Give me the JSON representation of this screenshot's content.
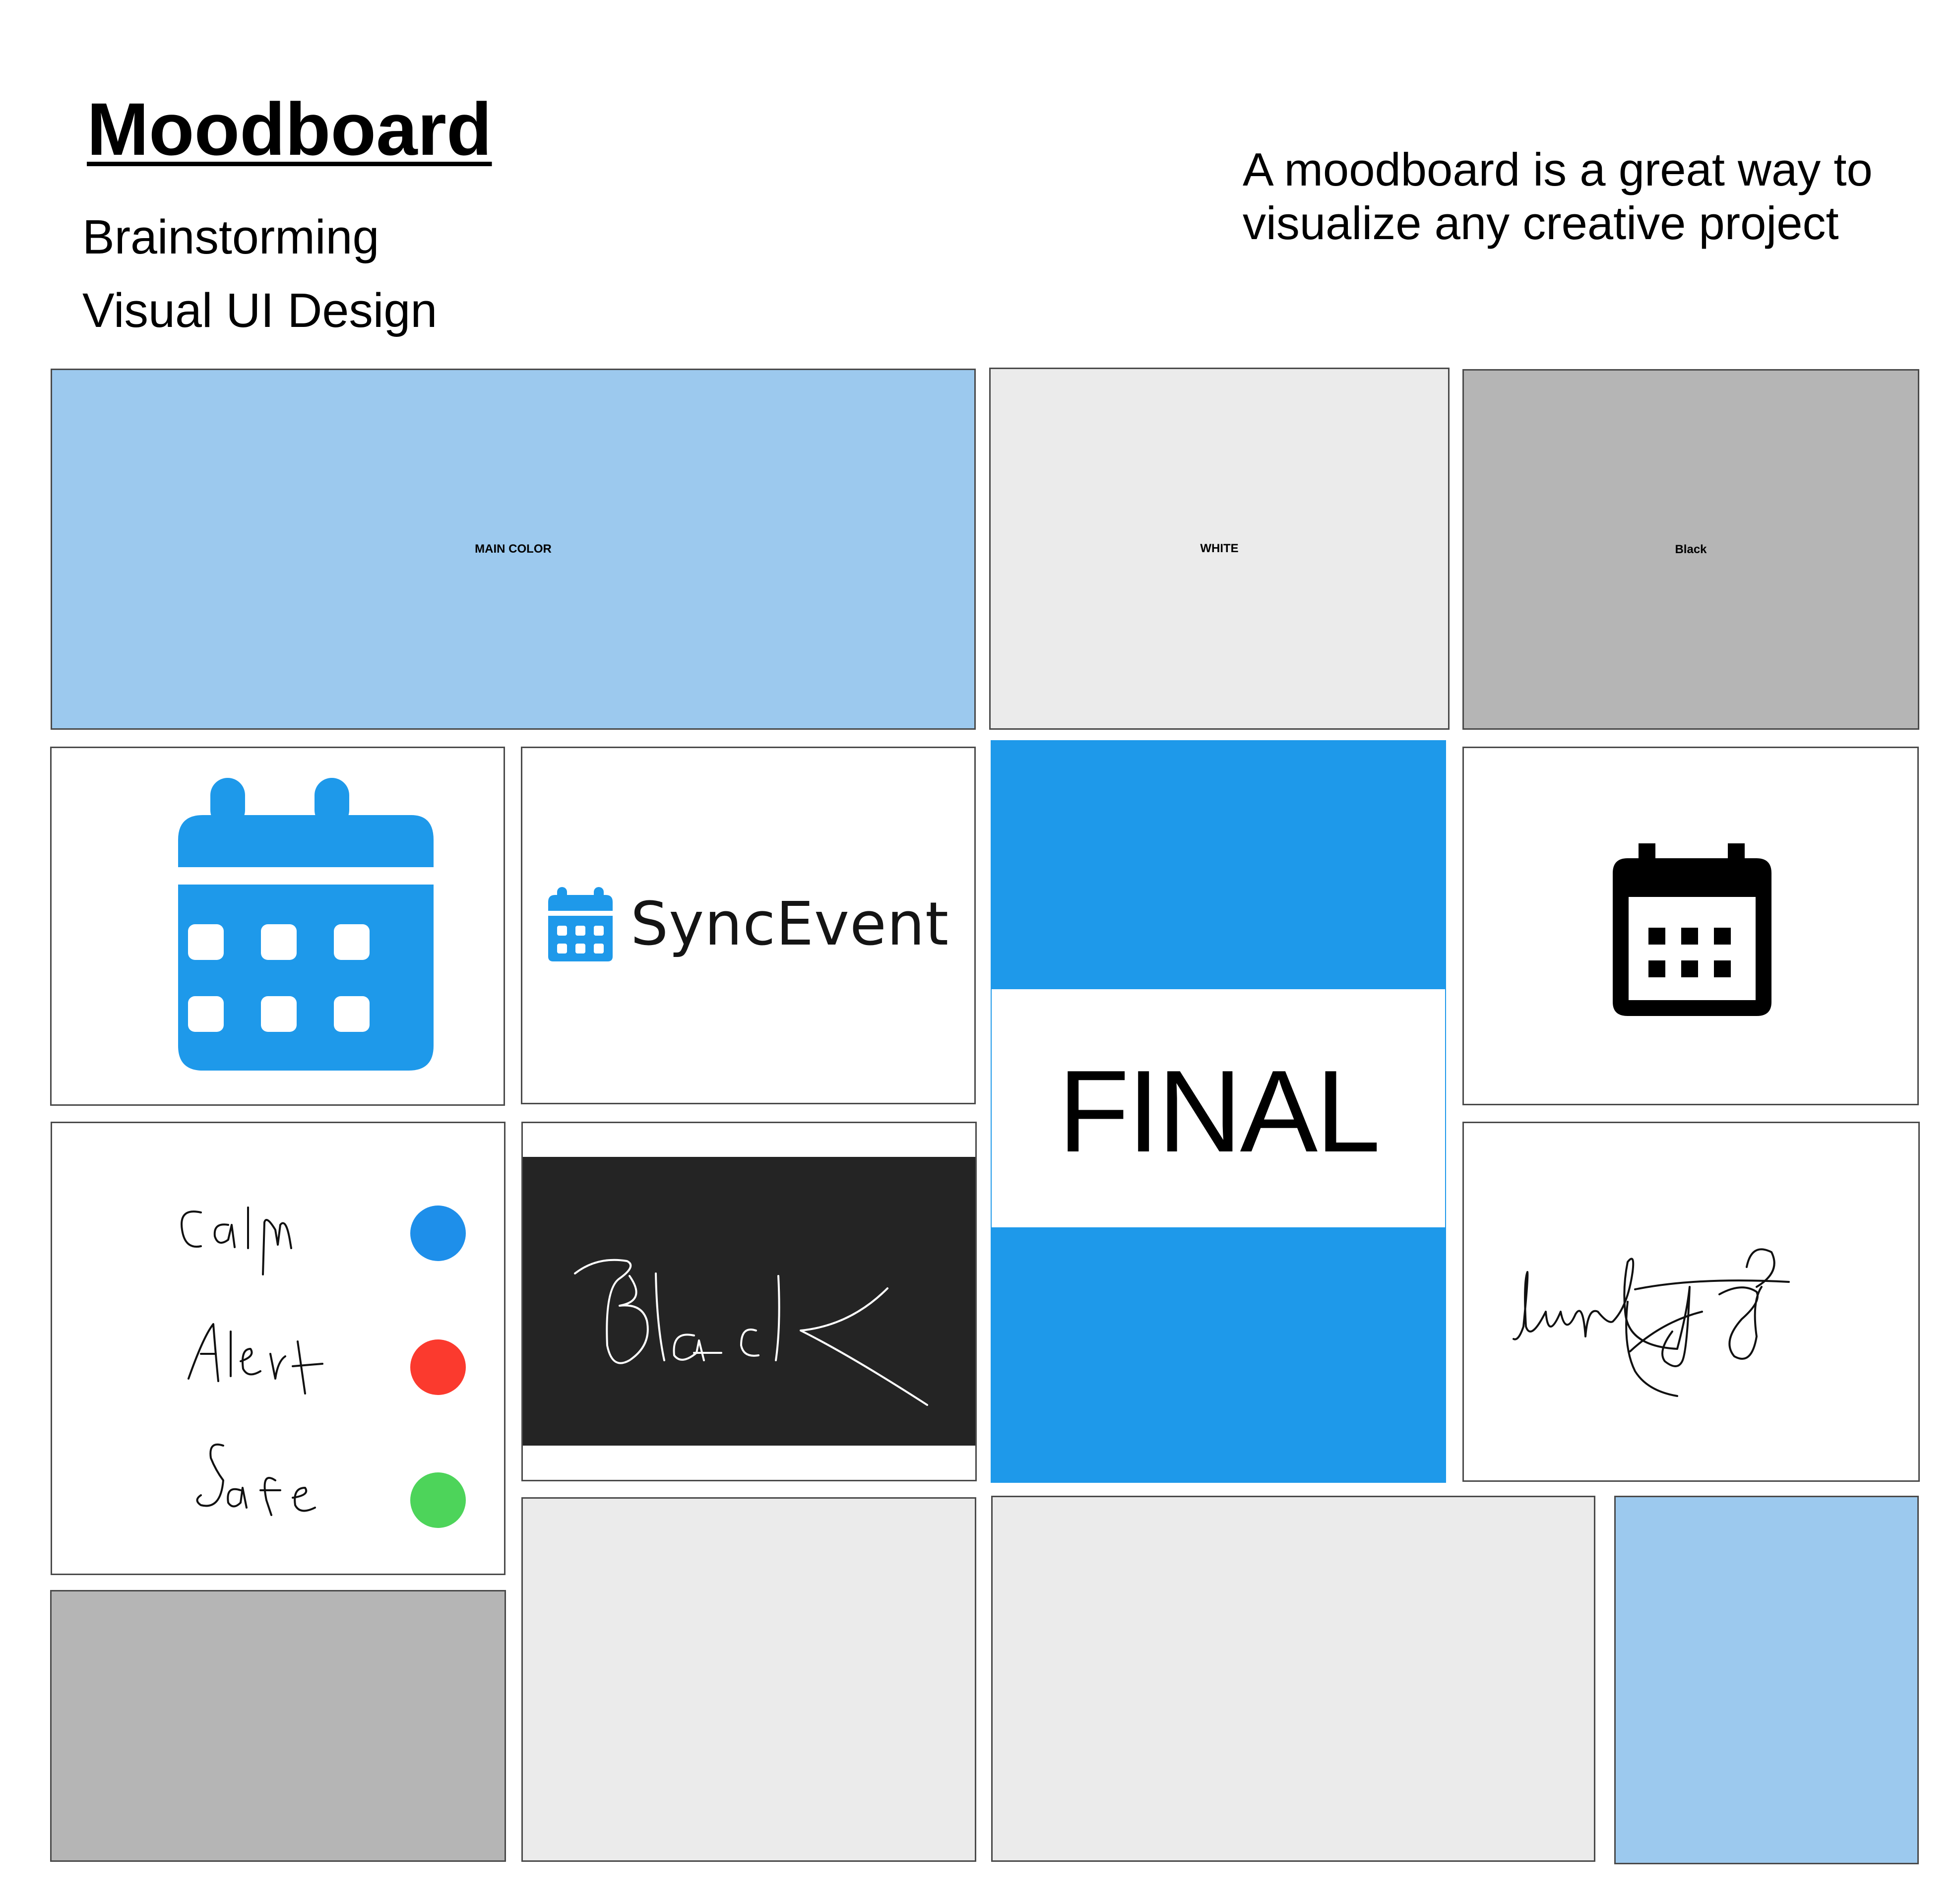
{
  "header": {
    "title": "Moodboard",
    "subtitles": [
      "Brainstorming",
      "Visual UI Design"
    ],
    "description": "A moodboard is a great way to visualize any creative project"
  },
  "swatches": {
    "main_color": {
      "label": "MAIN COLOR",
      "color": "#9cc9ee"
    },
    "white": {
      "label": "WHITE",
      "color": "#ebebeb"
    },
    "black": {
      "label": "Black",
      "color": "#b5b5b5"
    }
  },
  "logo": {
    "name": "SyncEvent",
    "icon": "calendar-icon",
    "color": "#1e99ea"
  },
  "final_tile": {
    "label": "FINAL",
    "accent": "#1e99ea"
  },
  "moods": {
    "items": [
      {
        "label": "Calm",
        "color": "#1e8fea"
      },
      {
        "label": "Alert",
        "color": "#fb3a2e"
      },
      {
        "label": "Safe",
        "color": "#4dd45a"
      }
    ]
  },
  "handwritten_black": {
    "label": "Black"
  },
  "bottom_swatches": {
    "colors": [
      "#b5b5b5",
      "#ebebeb",
      "#ebebeb",
      "#9cc9ee"
    ]
  }
}
